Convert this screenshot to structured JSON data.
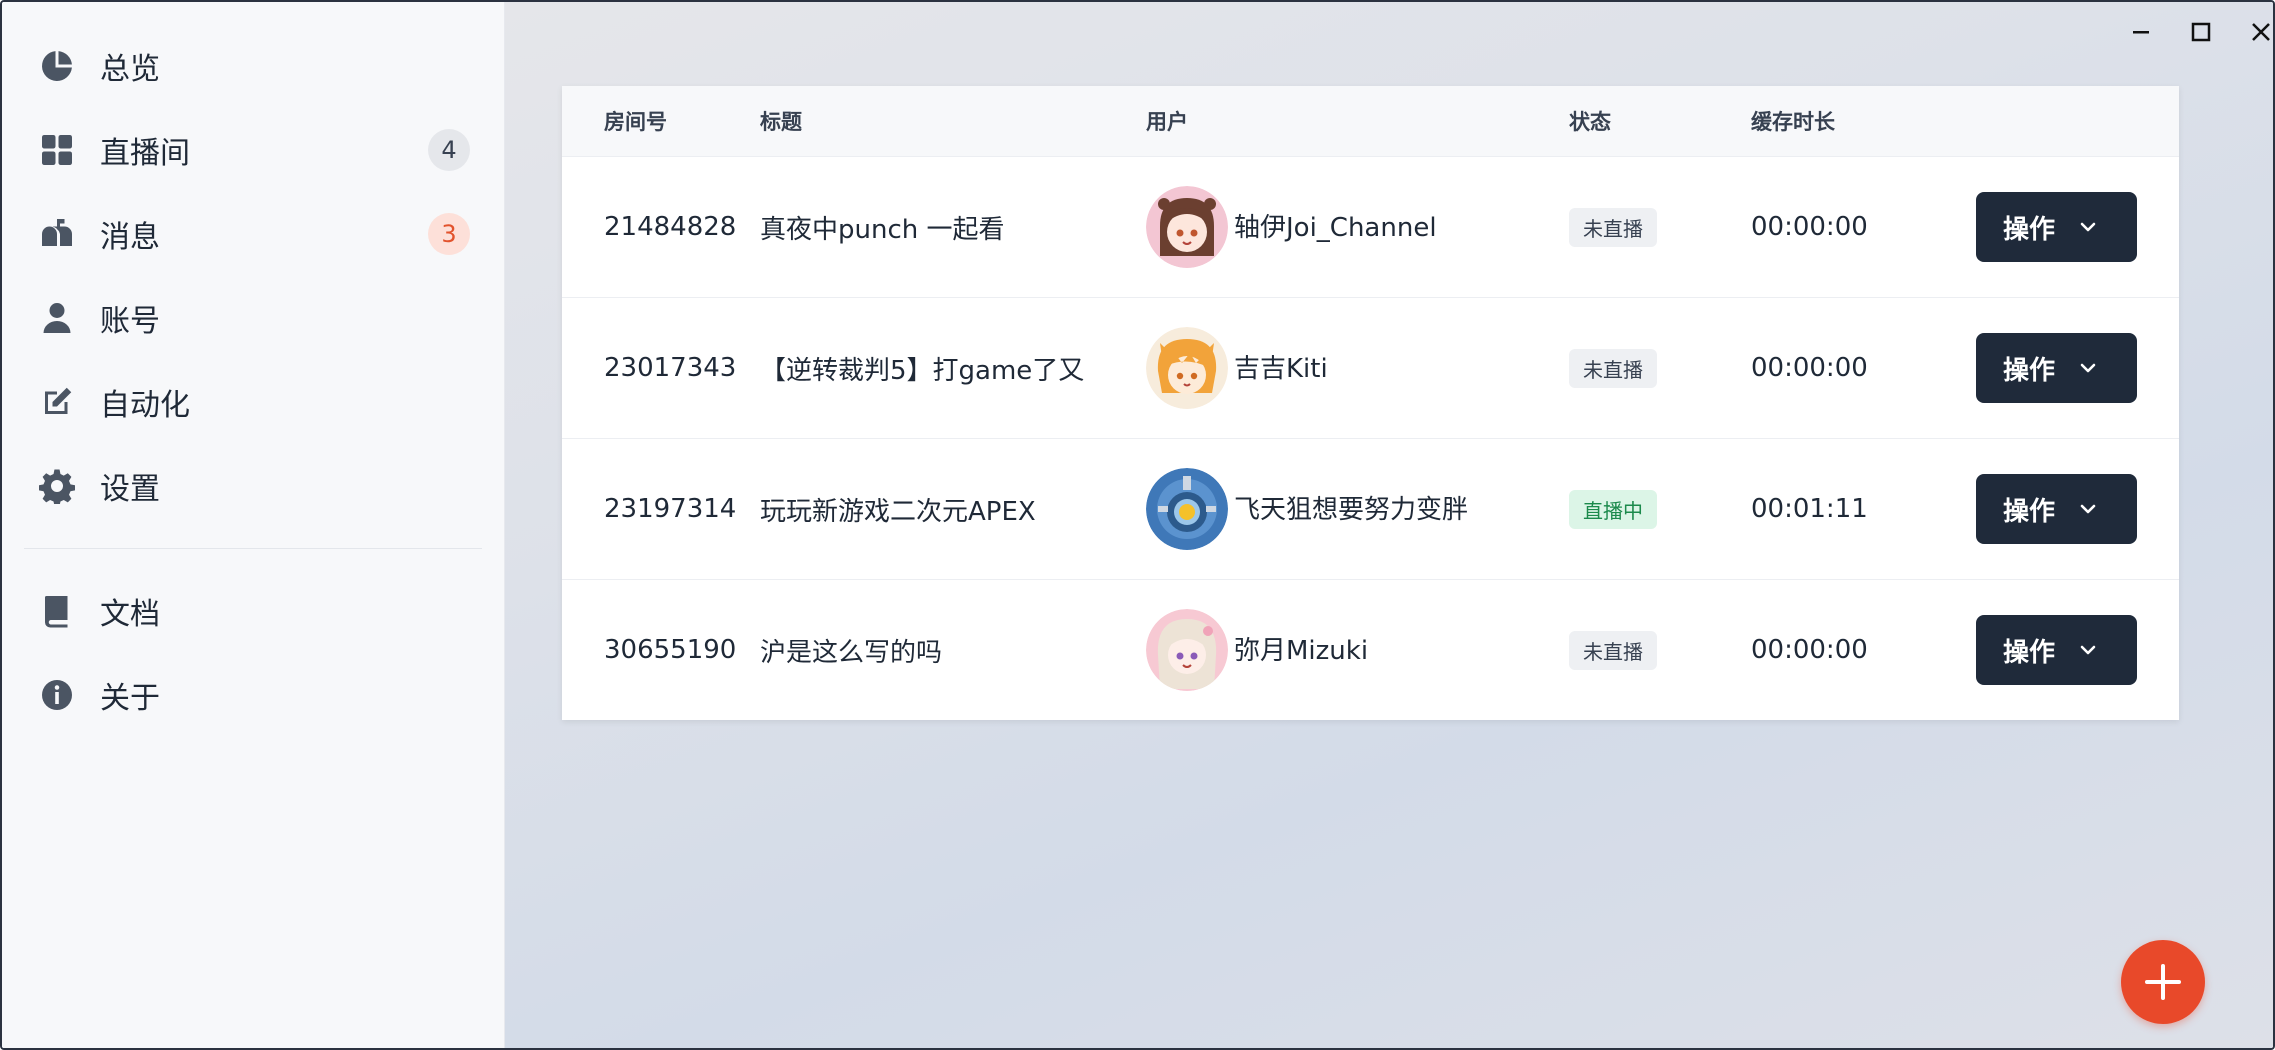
{
  "sidebar": {
    "items": [
      {
        "label": "总览",
        "icon": "pie-chart-icon"
      },
      {
        "label": "直播间",
        "icon": "grid-icon",
        "badge": "4"
      },
      {
        "label": "消息",
        "icon": "mailbox-icon",
        "badge": "3"
      },
      {
        "label": "账号",
        "icon": "user-icon"
      },
      {
        "label": "自动化",
        "icon": "edit-icon"
      },
      {
        "label": "设置",
        "icon": "gear-icon"
      }
    ],
    "secondary_items": [
      {
        "label": "文档",
        "icon": "book-icon"
      },
      {
        "label": "关于",
        "icon": "info-icon"
      }
    ]
  },
  "table": {
    "headers": {
      "room": "房间号",
      "title": "标题",
      "user": "用户",
      "status": "状态",
      "duration": "缓存时长"
    },
    "rows": [
      {
        "room": "21484828",
        "title": "真夜中punch 一起看",
        "user": "轴伊Joi_Channel",
        "status": "未直播",
        "duration": "00:00:00",
        "action": "操作"
      },
      {
        "room": "23017343",
        "title": "【逆转裁判5】打game了又",
        "user": "吉吉Kiti",
        "status": "未直播",
        "duration": "00:00:00",
        "action": "操作"
      },
      {
        "room": "23197314",
        "title": "玩玩新游戏二次元APEX",
        "user": "飞天狙想要努力变胖",
        "status": "直播中",
        "duration": "00:01:11",
        "action": "操作"
      },
      {
        "room": "30655190",
        "title": "沪是这么写的吗",
        "user": "弥月Mizuki",
        "status": "未直播",
        "duration": "00:00:00",
        "action": "操作"
      }
    ]
  },
  "colors": {
    "accent": "#e8492a",
    "button_dark": "#1f2a3a",
    "status_live_bg": "#dcf5e7",
    "status_live_text": "#1c8a4c",
    "badge_alert_text": "#e2532d"
  }
}
